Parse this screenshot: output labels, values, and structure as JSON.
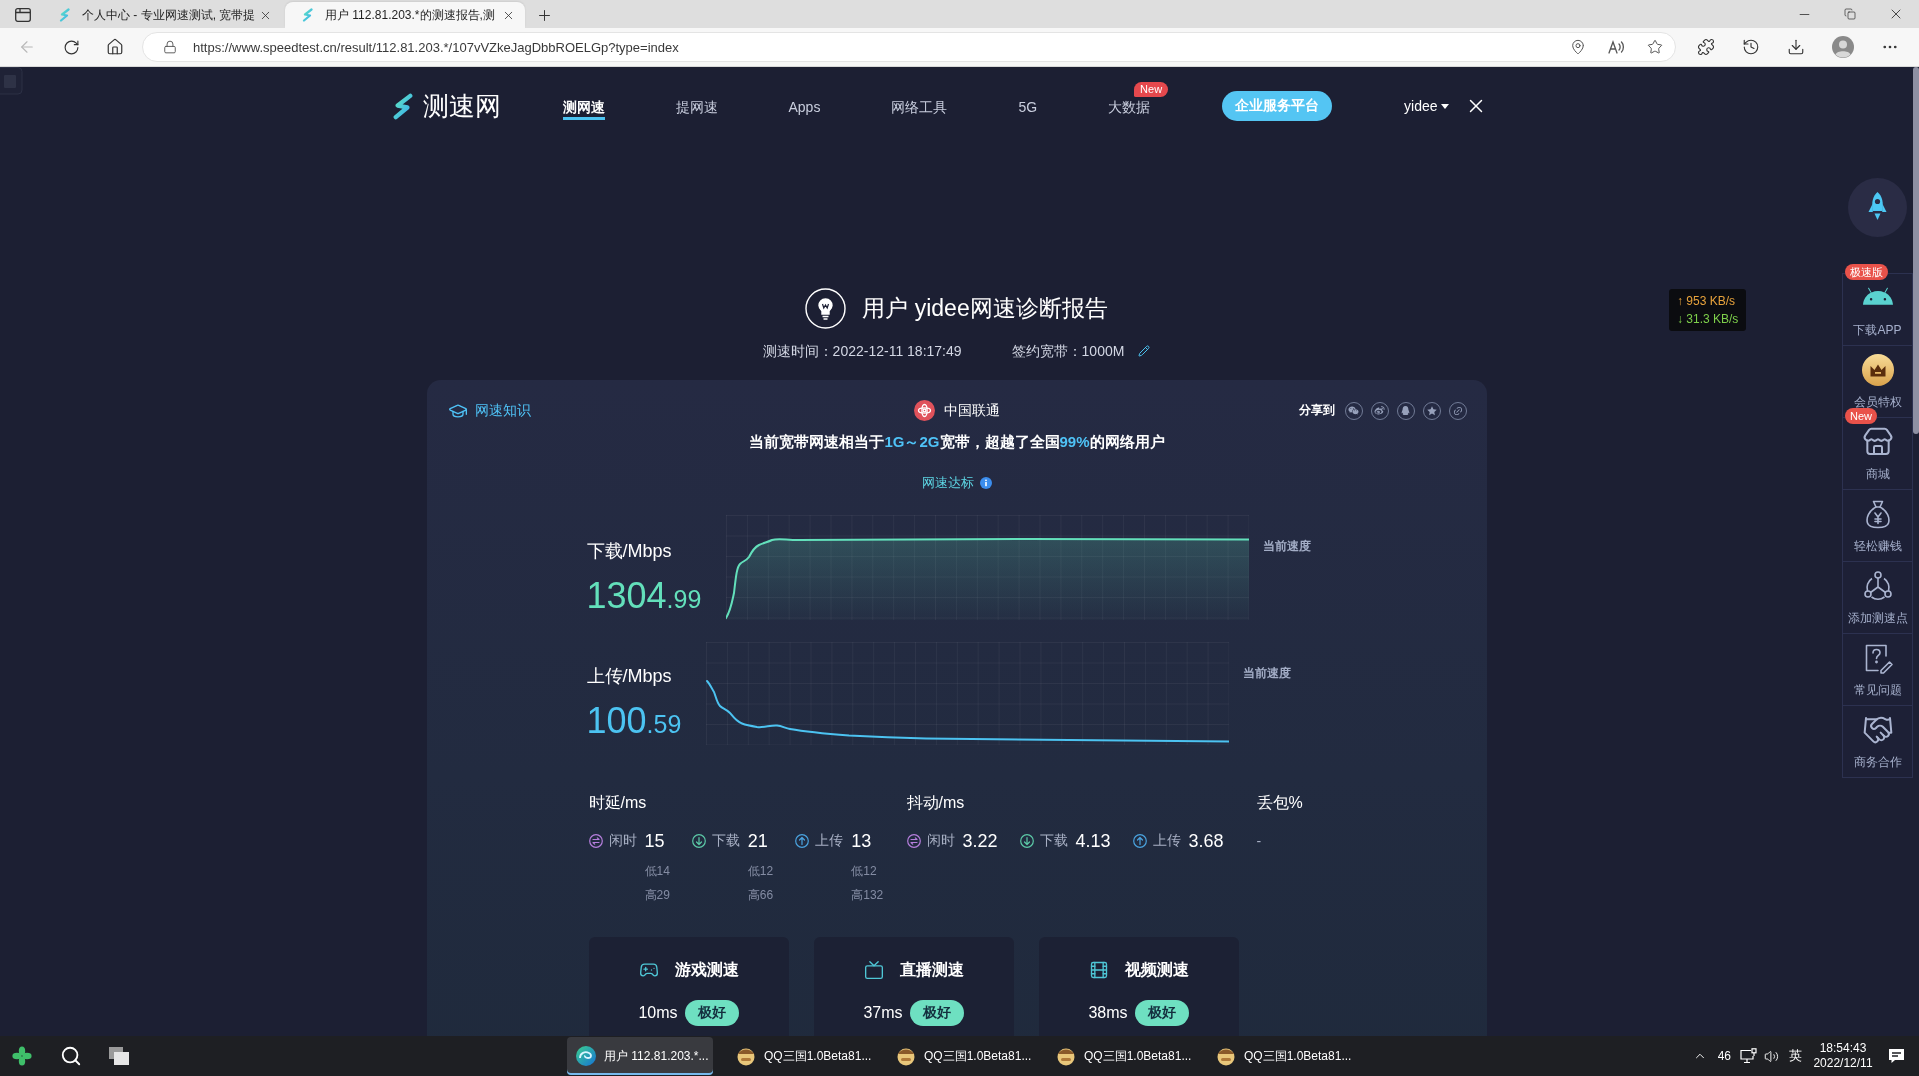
{
  "browser": {
    "back_button": {
      "disabled": true
    },
    "tabs": [
      {
        "title": "个人中心 - 专业网速测试, 宽带提",
        "selected": false
      },
      {
        "title": "用户 112.81.203.*的测速报告,测",
        "selected": true
      }
    ],
    "url": "https://www.speedtest.cn/result/112.81.203.*/107vVZkeJagDbbROELGp?type=index"
  },
  "nav": {
    "logo": "测速网",
    "items": [
      {
        "label": "测网速",
        "selected": true
      },
      {
        "label": "提网速",
        "selected": false
      },
      {
        "label": "Apps",
        "selected": false
      },
      {
        "label": "网络工具",
        "selected": false
      },
      {
        "label": "5G",
        "selected": false
      },
      {
        "label": "大数据",
        "selected": false,
        "badge": "New"
      }
    ],
    "enterprise_button": "企业服务平台",
    "user": "yidee"
  },
  "report": {
    "title": "用户 yidee网速诊断报告",
    "test_time": "测速时间：2022-12-11 18:17:49",
    "bandwidth": "签约宽带：1000M"
  },
  "card": {
    "knowledge_link": "网速知识",
    "isp": "中国联通",
    "share_label": "分享到",
    "summary": "当前宽带网速相当于**1G～2G**宽带，超越了全国**99%**的网络用户",
    "standard_link": "网速达标",
    "speeds": [
      {
        "kind": "download",
        "label": "下载/Mbps",
        "value": "1304.99",
        "current_label": "当前速度"
      },
      {
        "kind": "upload",
        "label": "上传/Mbps",
        "value": "100.59",
        "current_label": "当前速度"
      }
    ],
    "metrics": [
      {
        "title": "时延/ms",
        "items": [
          {
            "kind": "idle",
            "label": "闲时",
            "value": "15",
            "low": "低14",
            "high": "高29"
          },
          {
            "kind": "down",
            "label": "下载",
            "value": "21",
            "low": "低12",
            "high": "高66"
          },
          {
            "kind": "up",
            "label": "上传",
            "value": "13",
            "low": "低12",
            "high": "高132"
          }
        ]
      },
      {
        "title": "抖动/ms",
        "items": [
          {
            "kind": "idle",
            "label": "闲时",
            "value": "3.22"
          },
          {
            "kind": "down",
            "label": "下载",
            "value": "4.13"
          },
          {
            "kind": "up",
            "label": "上传",
            "value": "3.68"
          }
        ]
      },
      {
        "title": "丢包%",
        "value": "-"
      }
    ],
    "tests": [
      {
        "kind": "game",
        "title": "游戏测速",
        "latency": "10ms",
        "rating": "极好"
      },
      {
        "kind": "live",
        "title": "直播测速",
        "latency": "37ms",
        "rating": "极好"
      },
      {
        "kind": "video",
        "title": "视频测速",
        "latency": "38ms",
        "rating": "极好"
      }
    ]
  },
  "sidebar": [
    {
      "kind": "android",
      "label": "下载APP",
      "badge": "极速版"
    },
    {
      "kind": "vip",
      "label": "会员特权"
    },
    {
      "kind": "shop",
      "label": "商城",
      "badge": "New"
    },
    {
      "kind": "money",
      "label": "轻松赚钱"
    },
    {
      "kind": "node",
      "label": "添加测速点"
    },
    {
      "kind": "faq",
      "label": "常见问题"
    },
    {
      "kind": "deal",
      "label": "商务合作"
    }
  ],
  "speed_widget": {
    "upload": "↑ 953 KB/s",
    "download": "↓ 31.3 KB/s"
  },
  "taskbar": {
    "apps": [
      {
        "kind": "browser",
        "title": "用户 112.81.203.*...",
        "selected": true
      },
      {
        "kind": "game",
        "title": "QQ三国1.0Beta81...",
        "selected": false
      },
      {
        "kind": "game",
        "title": "QQ三国1.0Beta81...",
        "selected": false
      },
      {
        "kind": "game",
        "title": "QQ三国1.0Beta81...",
        "selected": false
      },
      {
        "kind": "game",
        "title": "QQ三国1.0Beta81...",
        "selected": false
      }
    ],
    "tray": {
      "indicator": "46",
      "input_method": "英",
      "time": "18:54:43",
      "date": "2022/12/11"
    }
  }
}
